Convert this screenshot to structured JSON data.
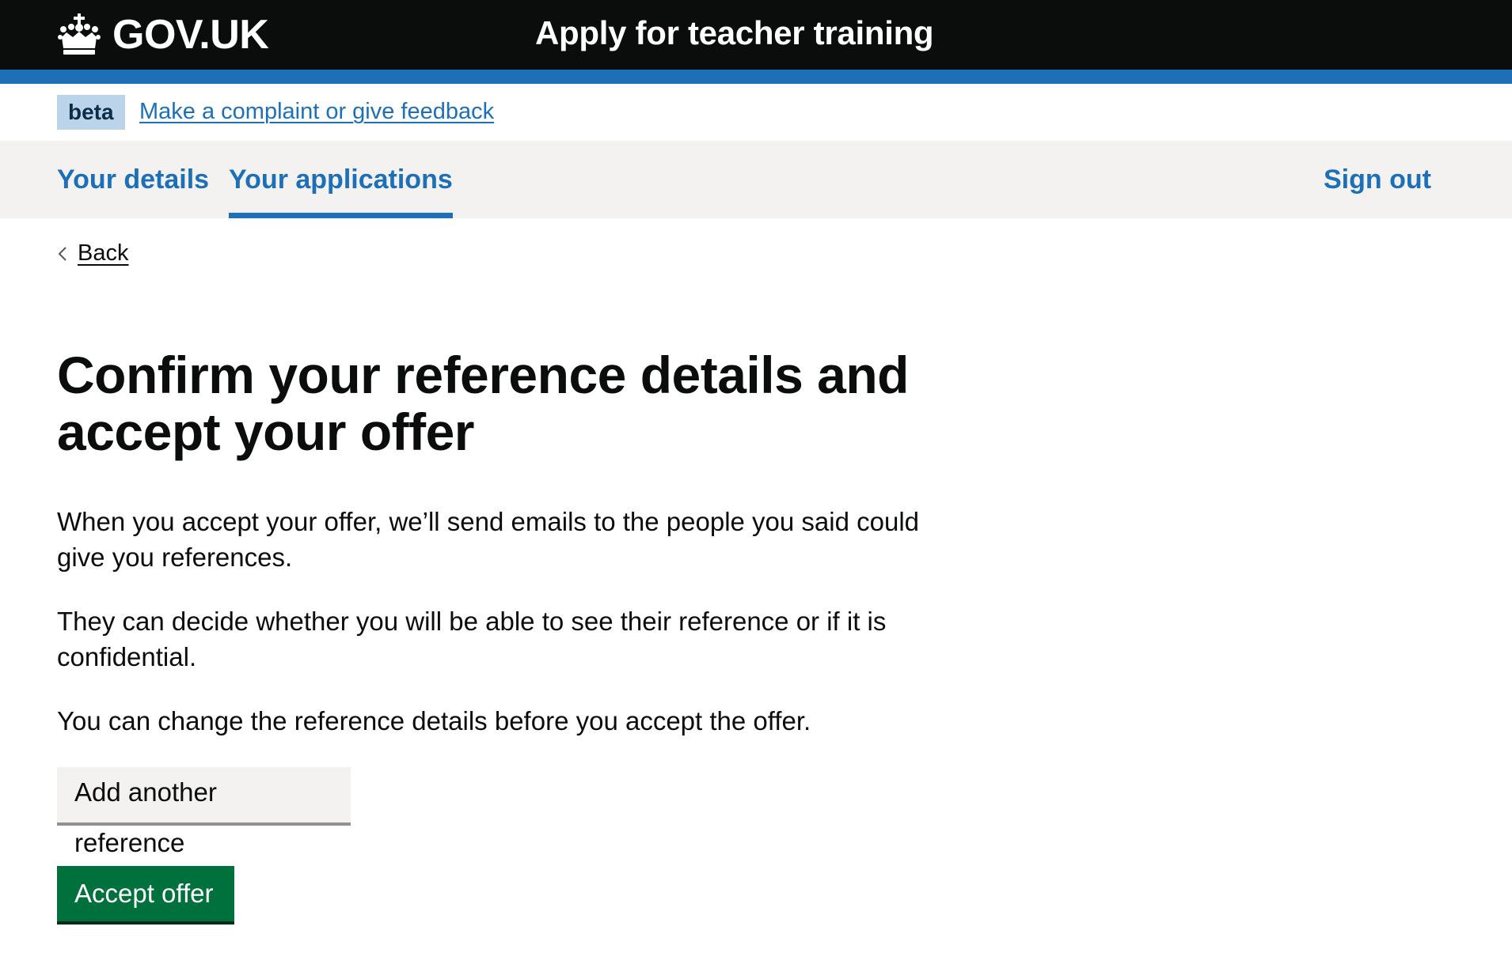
{
  "header": {
    "logo_text": "GOV.UK",
    "logo_icon": "crown-icon",
    "service_name": "Apply for teacher training",
    "colors": {
      "background": "#0b0c0c",
      "stripe": "#1d70b8"
    }
  },
  "phase_banner": {
    "tag": "beta",
    "link": "Make a complaint or give feedback"
  },
  "nav": {
    "items": [
      {
        "label": "Your details",
        "current": false
      },
      {
        "label": "Your applications",
        "current": true
      }
    ],
    "sign_out": "Sign out"
  },
  "back_link": {
    "label": "Back",
    "icon": "chevron-left-icon"
  },
  "main": {
    "title": "Confirm your reference details and accept your offer",
    "paragraphs": [
      "When you accept your offer, we’ll send emails to the people you said could give you references.",
      "They can decide whether you will be able to see their reference or if it is confidential.",
      "You can change the reference details before you accept the offer."
    ],
    "add_reference_button": "Add another reference",
    "accept_offer_button": "Accept offer"
  },
  "colors": {
    "link": "#1d70b8",
    "primary_button": "#00703c",
    "secondary_button": "#f3f2f1",
    "beta_tag": "#bbd4ea"
  }
}
